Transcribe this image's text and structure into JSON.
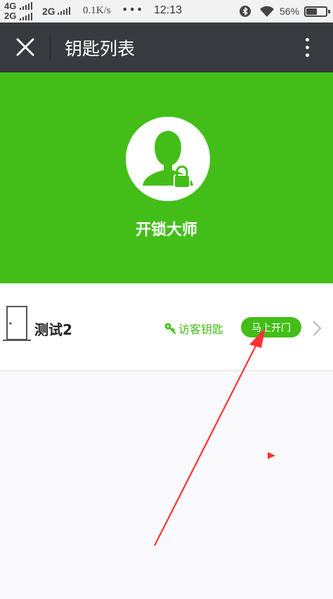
{
  "status_bar": {
    "net1": "4G",
    "net2": "2G",
    "net3": "2G",
    "speed": "0.1K/s",
    "more": "•••",
    "time": "12:13",
    "battery": "56%",
    "battery_level": 0.56
  },
  "title_bar": {
    "title": "钥匙列表",
    "close_icon": "close-icon",
    "more_icon": "more-vertical-icon"
  },
  "hero": {
    "avatar_icon": "user-lock-icon",
    "name": "开锁大师"
  },
  "key_list": [
    {
      "icon": "door-icon",
      "name": "测试2",
      "visitor_key_label": "访客钥匙",
      "open_button_label": "马上开门"
    }
  ],
  "colors": {
    "green": "#43be19",
    "title_bar": "#393a3f",
    "annotation": "#ff3333"
  }
}
